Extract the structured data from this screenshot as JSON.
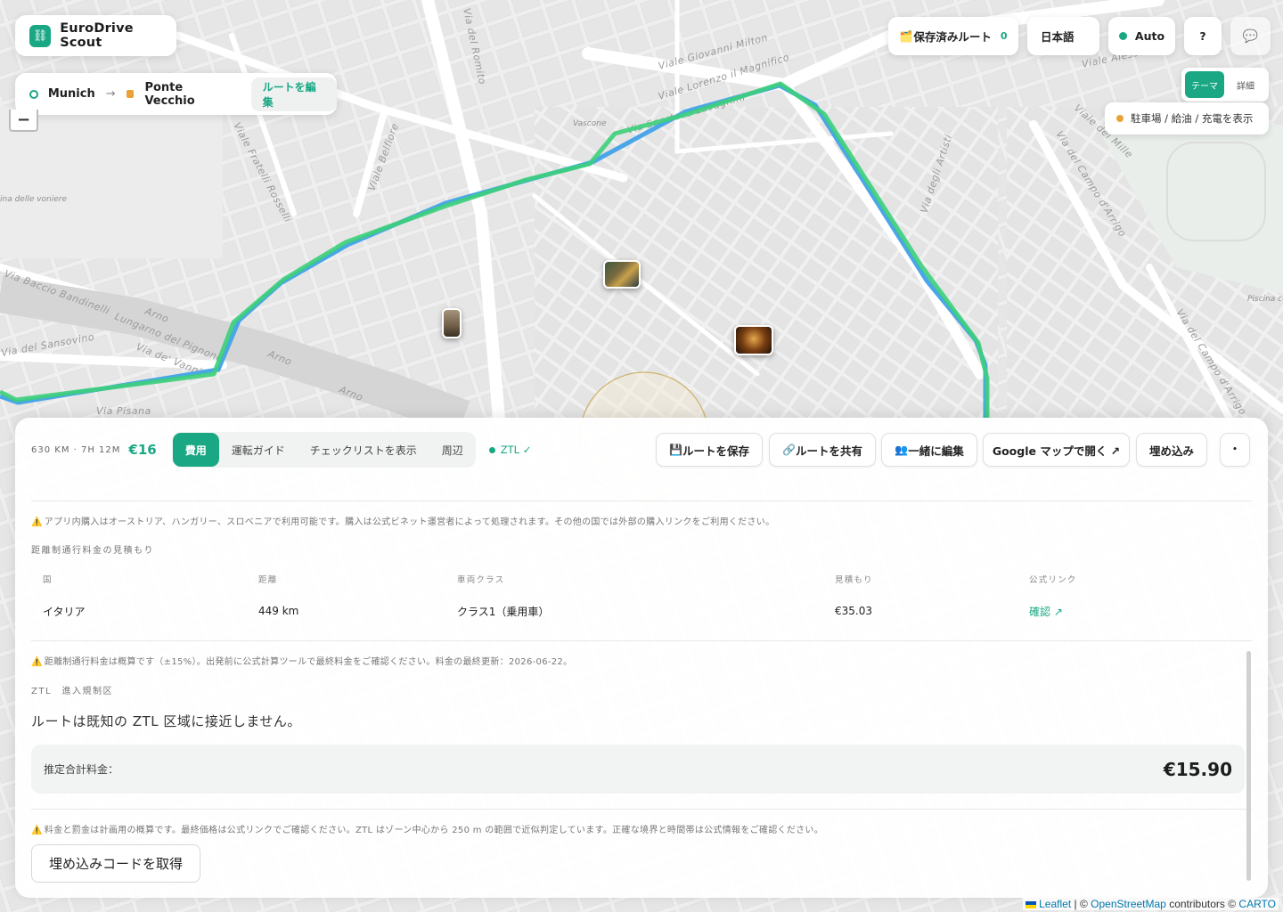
{
  "app": {
    "title": "EuroDrive Scout"
  },
  "route": {
    "origin": "Munich",
    "arrow": "→",
    "destination": "Ponte Vecchio",
    "edit_label": "ルートを編集"
  },
  "header": {
    "saved_routes_label": "保存済みルート",
    "saved_routes_count": "0",
    "language": "日本語",
    "mode": "Auto",
    "help": "?",
    "chat_icon": "💬",
    "saved_icon": "🗂️"
  },
  "map": {
    "zoom_out": "−",
    "theme_tabs": [
      "テーマ",
      "詳細"
    ],
    "poi_toggle": "駐車場 / 給油 / 充電を表示",
    "street_labels": [
      "Viale Giovanni Milton",
      "Viale Lorenzo il Magnifico",
      "Via Spartaco Lavagnini",
      "Viale Belfiore",
      "Viale Fratelli Rosselli",
      "Via Baccio Bandinelli",
      "Lungarno del Pignone",
      "Via de' Vanni",
      "Via del Sansovino",
      "Via Pisana",
      "Arno",
      "Arno",
      "Arno",
      "Via degli Artisti",
      "Via del Campo d'Arrigo",
      "Viale dei Mille",
      "Via del Romito",
      "Viale Alessandro",
      "Via del Campo d'Arrigo"
    ],
    "poi_labels": [
      "Vascone",
      "Piscina comunale Pa Costoli",
      "ina delle voniere"
    ],
    "attribution": {
      "leaflet": "Leaflet",
      "osm": "OpenStreetMap",
      "contrib": "contributors ©",
      "carto": "CARTO",
      "sep": "| ©"
    }
  },
  "panel": {
    "summary": "630 KM · 7H 12M",
    "cost": "€16",
    "tabs": [
      "費用",
      "運転ガイド",
      "チェックリストを表示",
      "周辺"
    ],
    "ztl_badge": "ZTL ✓",
    "actions": {
      "save": "ルートを保存",
      "save_icon": "💾",
      "share": "ルートを共有",
      "share_icon": "🔗",
      "coedit": "一緒に編集",
      "coedit_icon": "👥",
      "google": "Google マップで開く ↗",
      "embed": "埋め込み",
      "more": "•"
    },
    "vignette_warning": "アプリ内購入はオーストリア、ハンガリー、スロベニアで利用可能です。購入は公式ビネット運営者によって処理されます。その他の国では外部の購入リンクをご利用ください。",
    "toll_section": "距離制通行料金の見積もり",
    "toll_table": {
      "headers": [
        "国",
        "距離",
        "車両クラス",
        "見積もり",
        "公式リンク"
      ],
      "rows": [
        {
          "country": "イタリア",
          "distance": "449 km",
          "class": "クラス1（乗用車）",
          "estimate": "€35.03",
          "link": "確認 ↗"
        }
      ]
    },
    "toll_warning": "距離制通行料金は概算です（±15%）。出発前に公式計算ツールで最終料金をご確認ください。料金の最終更新：2026-06-22。",
    "ztl_section": "ZTL　進入規制区",
    "ztl_message": "ルートは既知の ZTL 区域に接近しません。",
    "total_label": "推定合計料金：",
    "total_value": "€15.90",
    "final_warning": "料金と罰金は計画用の概算です。最終価格は公式リンクでご確認ください。ZTL はゾーン中心から 250 m の範囲で近似判定しています。正確な境界と時間帯は公式情報をご確認ください。",
    "embed_code_button": "埋め込みコードを取得",
    "warn_icon": "⚠️"
  },
  "colors": {
    "accent": "#1aa784",
    "route_green": "#3ccf7a",
    "route_blue": "#4aa6e8",
    "river": "#d9d9d9"
  }
}
